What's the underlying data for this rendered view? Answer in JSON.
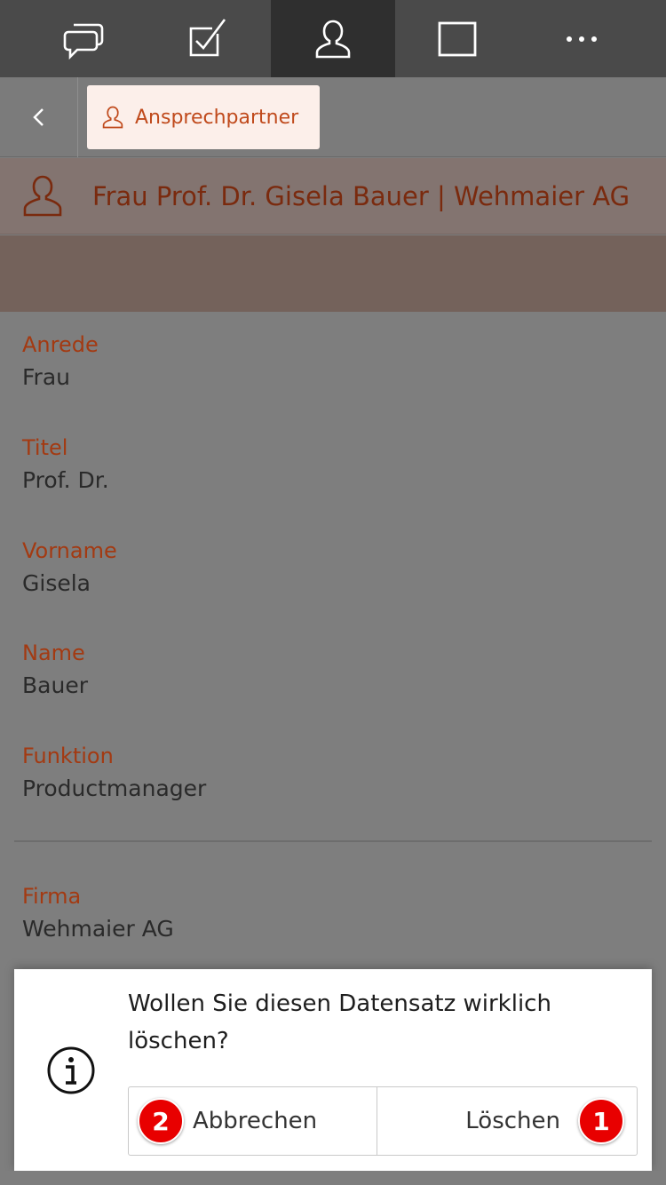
{
  "topbar": {
    "tabs": [
      {
        "icon": "chat-bubbles-icon"
      },
      {
        "icon": "checkbox-edit-icon"
      },
      {
        "icon": "person-icon",
        "active": true
      },
      {
        "icon": "window-icon"
      },
      {
        "icon": "more-dots-icon"
      }
    ]
  },
  "navbar": {
    "back_icon": "chevron-left-icon",
    "breadcrumb_label": "Ansprechpartner"
  },
  "header": {
    "title": "Frau Prof. Dr. Gisela Bauer | Wehmaier AG"
  },
  "fields": [
    {
      "label": "Anrede",
      "value": "Frau"
    },
    {
      "label": "Titel",
      "value": "Prof. Dr."
    },
    {
      "label": "Vorname",
      "value": "Gisela"
    },
    {
      "label": "Name",
      "value": "Bauer"
    },
    {
      "label": "Funktion",
      "value": "Productmanager"
    },
    {
      "label": "Firma",
      "value": "Wehmaier AG"
    }
  ],
  "dialog": {
    "message": "Wollen Sie diesen Datensatz wirklich löschen?",
    "cancel_label": "Abbrechen",
    "delete_label": "Löschen",
    "badge_cancel": "2",
    "badge_delete": "1"
  },
  "colors": {
    "accent": "#c04a1c",
    "label": "#a33a12",
    "badge": "#e80000"
  }
}
